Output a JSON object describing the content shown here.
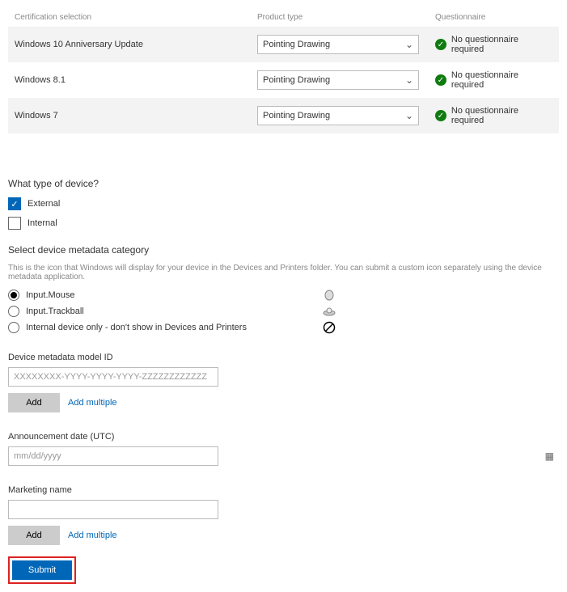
{
  "headers": {
    "cert": "Certification selection",
    "type": "Product type",
    "q": "Questionnaire"
  },
  "rows": [
    {
      "name": "Windows 10 Anniversary Update",
      "type": "Pointing Drawing",
      "q": "No questionnaire required"
    },
    {
      "name": "Windows 8.1",
      "type": "Pointing Drawing",
      "q": "No questionnaire required"
    },
    {
      "name": "Windows 7",
      "type": "Pointing Drawing",
      "q": "No questionnaire required"
    }
  ],
  "device_type": {
    "title": "What type of device?",
    "external": "External",
    "internal": "Internal"
  },
  "metadata_cat": {
    "title": "Select device metadata category",
    "hint": "This is the icon that Windows will display for your device in the Devices and Printers folder. You can submit a custom icon separately using the device metadata application.",
    "opts": [
      "Input.Mouse",
      "Input.Trackball",
      "Internal device only - don't show in Devices and Printers"
    ]
  },
  "model_id": {
    "label": "Device metadata model ID",
    "placeholder": "XXXXXXXX-YYYY-YYYY-YYYY-ZZZZZZZZZZZZ",
    "add": "Add",
    "multi": "Add multiple"
  },
  "announce": {
    "label": "Announcement date (UTC)",
    "placeholder": "mm/dd/yyyy"
  },
  "marketing": {
    "label": "Marketing name",
    "add": "Add",
    "multi": "Add multiple"
  },
  "submit": "Submit"
}
